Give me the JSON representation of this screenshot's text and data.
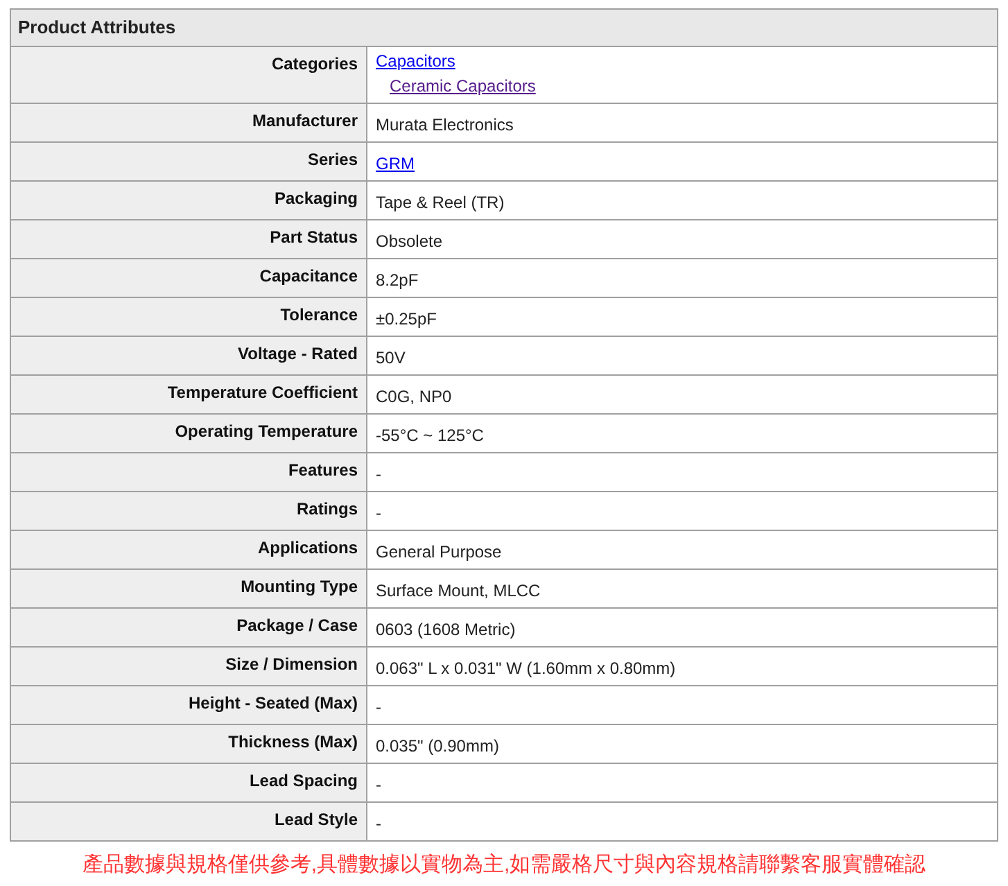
{
  "title": "Product Attributes",
  "rows": [
    {
      "label": "Categories",
      "values": [
        {
          "kind": "link",
          "text": "Capacitors",
          "visited": false,
          "children": [
            {
              "kind": "link",
              "text": "Ceramic Capacitors",
              "visited": true
            }
          ]
        }
      ]
    },
    {
      "label": "Manufacturer",
      "values": [
        {
          "kind": "text",
          "text": "Murata Electronics"
        }
      ]
    },
    {
      "label": "Series",
      "values": [
        {
          "kind": "link",
          "text": "GRM",
          "visited": false
        }
      ]
    },
    {
      "label": "Packaging",
      "values": [
        {
          "kind": "text",
          "text": "Tape & Reel (TR)"
        }
      ]
    },
    {
      "label": "Part Status",
      "values": [
        {
          "kind": "text",
          "text": "Obsolete"
        }
      ]
    },
    {
      "label": "Capacitance",
      "values": [
        {
          "kind": "text",
          "text": "8.2pF"
        }
      ]
    },
    {
      "label": "Tolerance",
      "values": [
        {
          "kind": "text",
          "text": "±0.25pF"
        }
      ]
    },
    {
      "label": "Voltage - Rated",
      "values": [
        {
          "kind": "text",
          "text": "50V"
        }
      ]
    },
    {
      "label": "Temperature Coefficient",
      "values": [
        {
          "kind": "text",
          "text": "C0G, NP0"
        }
      ]
    },
    {
      "label": "Operating Temperature",
      "values": [
        {
          "kind": "text",
          "text": "-55°C ~ 125°C"
        }
      ]
    },
    {
      "label": "Features",
      "values": [
        {
          "kind": "text",
          "text": "-"
        }
      ]
    },
    {
      "label": "Ratings",
      "values": [
        {
          "kind": "text",
          "text": "-"
        }
      ]
    },
    {
      "label": "Applications",
      "values": [
        {
          "kind": "text",
          "text": "General Purpose"
        }
      ]
    },
    {
      "label": "Mounting Type",
      "values": [
        {
          "kind": "text",
          "text": "Surface Mount, MLCC"
        }
      ]
    },
    {
      "label": "Package / Case",
      "values": [
        {
          "kind": "text",
          "text": "0603 (1608 Metric)"
        }
      ]
    },
    {
      "label": "Size / Dimension",
      "values": [
        {
          "kind": "text",
          "text": "0.063\" L x 0.031\" W (1.60mm x 0.80mm)"
        }
      ]
    },
    {
      "label": "Height - Seated (Max)",
      "values": [
        {
          "kind": "text",
          "text": "-"
        }
      ]
    },
    {
      "label": "Thickness (Max)",
      "values": [
        {
          "kind": "text",
          "text": "0.035\" (0.90mm)"
        }
      ]
    },
    {
      "label": "Lead Spacing",
      "values": [
        {
          "kind": "text",
          "text": "-"
        }
      ]
    },
    {
      "label": "Lead Style",
      "values": [
        {
          "kind": "text",
          "text": "-"
        }
      ]
    }
  ],
  "footnote": "產品數據與規格僅供參考,具體數據以實物為主,如需嚴格尺寸與內容規格請聯繫客服實體確認"
}
